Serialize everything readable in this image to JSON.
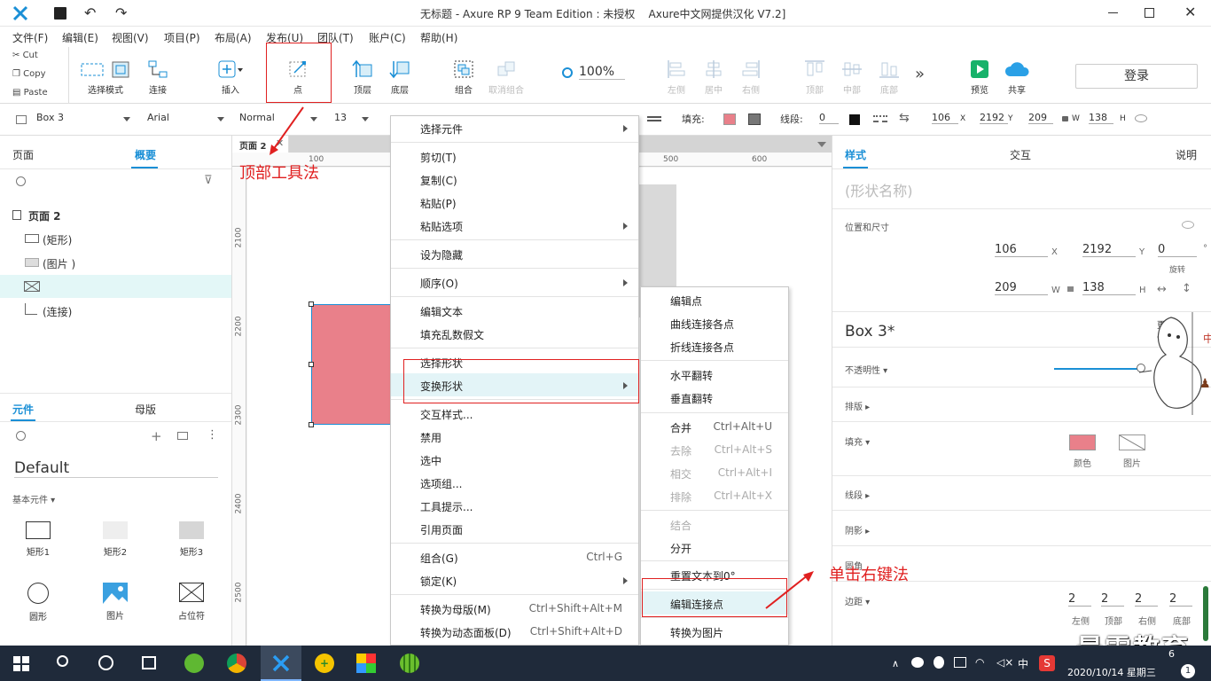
{
  "window": {
    "title": "无标题 - Axure RP 9 Team Edition : 未授权    Axure中文网提供汉化 V7.2]"
  },
  "menu": [
    "文件(F)",
    "编辑(E)",
    "视图(V)",
    "项目(P)",
    "布局(A)",
    "发布(U)",
    "团队(T)",
    "账户(C)",
    "帮助(H)"
  ],
  "clipboard": [
    "Cut",
    "Copy",
    "Paste"
  ],
  "toolbar": {
    "select_mode": "选择模式",
    "connect": "连接",
    "insert": "插入",
    "point": "点",
    "top": "顶层",
    "bottom": "底层",
    "group": "组合",
    "ungroup": "取消组合",
    "zoom": "100%",
    "align_left": "左侧",
    "align_center": "居中",
    "align_right": "右侧",
    "align_top": "顶部",
    "align_middle": "中部",
    "align_bottom": "底部",
    "preview": "预览",
    "share": "共享",
    "login": "登录"
  },
  "format": {
    "shape": "Box 3",
    "font": "Arial",
    "style": "Normal",
    "size": "13",
    "fill_label": "填充:",
    "line_label": "线段:",
    "line_width": "0",
    "x": "106",
    "x_l": "X",
    "y": "2192",
    "y_l": "Y",
    "w": "209",
    "w_l": "W",
    "h": "138",
    "h_l": "H"
  },
  "left": {
    "tab_pages": "页面",
    "tab_outline": "概要",
    "page": "页面 2",
    "items": [
      "(矩形)",
      "(图片 )",
      "",
      "(连接)"
    ],
    "tab_widgets": "元件",
    "tab_masters": "母版",
    "library": "Default",
    "category": "基本元件 ▾",
    "widgets": [
      "矩形1",
      "矩形2",
      "矩形3",
      "圆形",
      "图片",
      "占位符"
    ]
  },
  "canvas": {
    "tab": "页面 2",
    "ruler_top": [
      "100",
      "500",
      "600"
    ],
    "ruler_left": [
      "2100",
      "2200",
      "2300",
      "2400",
      "2500"
    ]
  },
  "context_menu": {
    "items": [
      {
        "l": "选择元件",
        "sub": true
      },
      {
        "l": "剪切(T)"
      },
      {
        "l": "复制(C)"
      },
      {
        "l": "粘贴(P)"
      },
      {
        "l": "粘贴选项",
        "sub": true
      },
      {
        "l": "设为隐藏"
      },
      {
        "l": "顺序(O)",
        "sub": true
      },
      {
        "l": "编辑文本"
      },
      {
        "l": "填充乱数假文"
      },
      {
        "l": "选择形状"
      },
      {
        "l": "变换形状",
        "sub": true
      },
      {
        "l": "交互样式..."
      },
      {
        "l": "禁用"
      },
      {
        "l": "选中"
      },
      {
        "l": "选项组..."
      },
      {
        "l": "工具提示..."
      },
      {
        "l": "引用页面"
      },
      {
        "l": "组合(G)",
        "s": "Ctrl+G"
      },
      {
        "l": "锁定(K)",
        "sub": true
      },
      {
        "l": "转换为母版(M)",
        "s": "Ctrl+Shift+Alt+M"
      },
      {
        "l": "转换为动态面板(D)",
        "s": "Ctrl+Shift+Alt+D"
      }
    ]
  },
  "submenu": {
    "items": [
      {
        "l": "编辑点"
      },
      {
        "l": "曲线连接各点"
      },
      {
        "l": "折线连接各点"
      },
      {
        "l": "水平翻转"
      },
      {
        "l": "垂直翻转"
      },
      {
        "l": "合并",
        "s": "Ctrl+Alt+U"
      },
      {
        "l": "去除",
        "s": "Ctrl+Alt+S",
        "d": true
      },
      {
        "l": "相交",
        "s": "Ctrl+Alt+I",
        "d": true
      },
      {
        "l": "排除",
        "s": "Ctrl+Alt+X",
        "d": true
      },
      {
        "l": "结合",
        "d": true
      },
      {
        "l": "分开"
      },
      {
        "l": "重置文本到0°"
      },
      {
        "l": "编辑连接点"
      },
      {
        "l": "转换为图片"
      }
    ]
  },
  "annotations": {
    "top_tool": "顶部工具法",
    "right_click": "单击右键法"
  },
  "right": {
    "tab_style": "样式",
    "tab_interact": "交互",
    "tab_notes": "说明",
    "shape_name_placeholder": "(形状名称)",
    "pos_size": "位置和尺寸",
    "x": "106",
    "y": "2192",
    "rot": "0",
    "rot_unit": "°",
    "rot_label": "旋转",
    "w": "209",
    "h": "138",
    "x_l": "X",
    "y_l": "Y",
    "w_l": "W",
    "h_l": "H",
    "box_name": "Box 3*",
    "more_1": "更多",
    "more_2": "创",
    "opacity": "不透明性 ▾",
    "layout": "排版 ▸",
    "fill": "填充 ▾",
    "fill_color": "颜色",
    "fill_image": "图片",
    "line": "线段 ▸",
    "shadow": "阴影 ▸",
    "corner": "圆角",
    "padding": "边距 ▾",
    "pad": [
      "2",
      "2",
      "2",
      "2"
    ],
    "pad_l": [
      "左侧",
      "顶部",
      "右侧",
      "底部"
    ]
  },
  "taskbar": {
    "datetime": "2020/10/14 星期三",
    "lang": "中",
    "time_frag": "6"
  },
  "watermark": "最需教育",
  "colors": {
    "accent": "#1a8fd6",
    "shape_fill": "#e9808a",
    "highlight": "#e3f4f7",
    "red": "#e02020"
  }
}
